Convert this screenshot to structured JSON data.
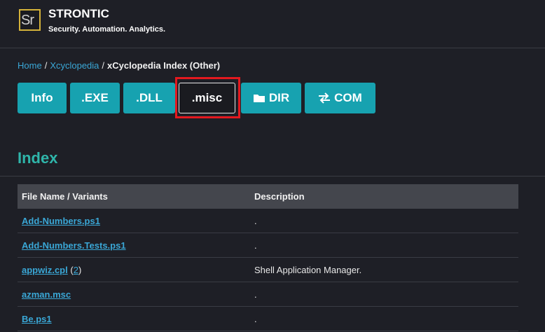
{
  "brand": {
    "logo_text": "Sr",
    "name": "STRONTIC",
    "tagline": "Security. Automation. Analytics."
  },
  "breadcrumb": {
    "home": "Home",
    "section": "Xcyclopedia",
    "current": "xCyclopedia Index (Other)",
    "separator": "/"
  },
  "nav_buttons": [
    {
      "label": "Info",
      "active": false
    },
    {
      "label": ".EXE",
      "active": false
    },
    {
      "label": ".DLL",
      "active": false
    },
    {
      "label": ".misc",
      "active": true
    },
    {
      "label": "DIR",
      "icon": "folder-icon",
      "active": false
    },
    {
      "label": "COM",
      "icon": "exchange-arrows-icon",
      "active": false
    }
  ],
  "index": {
    "title": "Index",
    "columns": [
      "File Name / Variants",
      "Description"
    ],
    "rows": [
      {
        "name": "Add-Numbers.ps1",
        "variants": "",
        "description": "."
      },
      {
        "name": "Add-Numbers.Tests.ps1",
        "variants": "",
        "description": "."
      },
      {
        "name": "appwiz.cpl",
        "variants": "2",
        "description": "Shell Application Manager."
      },
      {
        "name": "azman.msc",
        "variants": "",
        "description": "."
      },
      {
        "name": "Be.ps1",
        "variants": "",
        "description": "."
      }
    ]
  },
  "colors": {
    "background": "#1e1f26",
    "accent": "#17a2b0",
    "link": "#3aa7d6",
    "highlight": "#e3191f",
    "index_title": "#2fb5aa"
  }
}
